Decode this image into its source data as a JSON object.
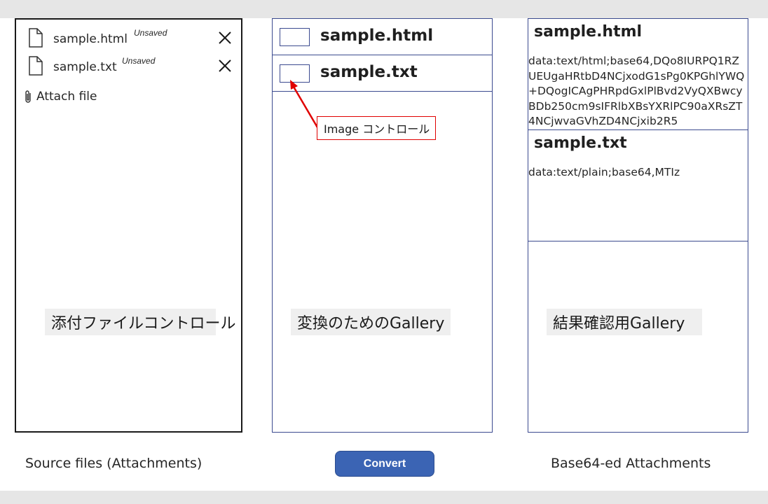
{
  "attachments": {
    "items": [
      {
        "name": "sample.html",
        "status": "Unsaved"
      },
      {
        "name": "sample.txt",
        "status": "Unsaved"
      }
    ],
    "attach_label": "Attach file",
    "section_label": "添付ファイルコントロール",
    "caption": "Source files (Attachments)"
  },
  "conversion_gallery": {
    "items": [
      {
        "title": "sample.html"
      },
      {
        "title": "sample.txt"
      }
    ],
    "callout": "Image コントロール",
    "section_label": "変換のためのGallery",
    "button_label": "Convert"
  },
  "result_gallery": {
    "items": [
      {
        "title": "sample.html",
        "data": "data:text/html;base64,DQo8IURPQ1RZUEUgaHRtbD4NCjxodG1sPg0KPGhlYWQ+DQogICAgPHRpdGxlPlBvd2VyQXBwcyBDb250cm9sIFRlbXBsYXRlPC90aXRsZT4NCjwvaGVhZD4NCjxib2R5"
      },
      {
        "title": "sample.txt",
        "data": "data:text/plain;base64,MTIz"
      }
    ],
    "section_label": "結果確認用Gallery",
    "caption": "Base64-ed Attachments"
  },
  "colors": {
    "gallery_border": "#3b4a8f",
    "button_bg": "#3b64b4",
    "callout_red": "#e00000",
    "label_bg": "#efefef"
  },
  "icons": {
    "file": "file-icon",
    "remove": "close-icon",
    "attach": "paperclip-icon"
  }
}
